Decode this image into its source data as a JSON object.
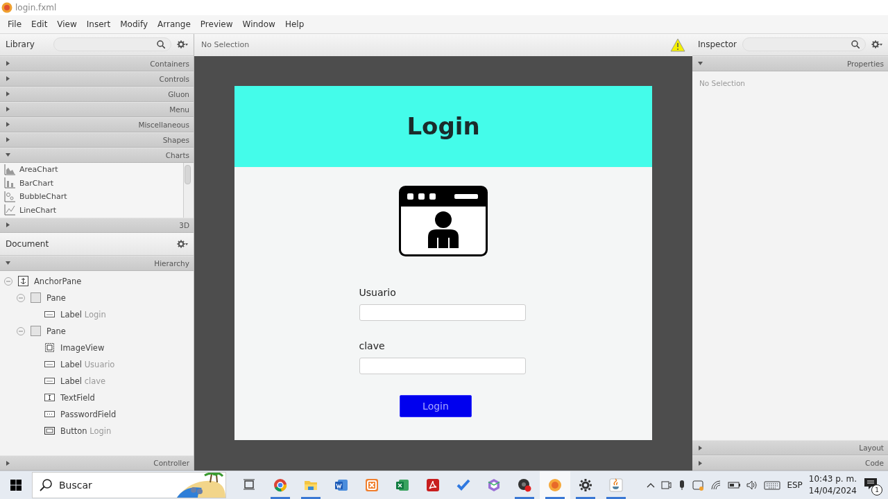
{
  "window": {
    "title": "login.fxml"
  },
  "menu": [
    "File",
    "Edit",
    "View",
    "Insert",
    "Modify",
    "Arrange",
    "Preview",
    "Window",
    "Help"
  ],
  "library": {
    "title": "Library",
    "sections": [
      {
        "label": "Containers",
        "expanded": false
      },
      {
        "label": "Controls",
        "expanded": false
      },
      {
        "label": "Gluon",
        "expanded": false
      },
      {
        "label": "Menu",
        "expanded": false
      },
      {
        "label": "Miscellaneous",
        "expanded": false
      },
      {
        "label": "Shapes",
        "expanded": false
      },
      {
        "label": "Charts",
        "expanded": true,
        "items": [
          {
            "kind": "area",
            "label": "AreaChart"
          },
          {
            "kind": "bar",
            "label": "BarChart"
          },
          {
            "kind": "bubble",
            "label": "BubbleChart"
          },
          {
            "kind": "line",
            "label": "LineChart"
          }
        ]
      },
      {
        "label": "3D",
        "expanded": false
      }
    ]
  },
  "document": {
    "title": "Document",
    "section": "Hierarchy",
    "section_expanded": true,
    "tree": [
      {
        "kind": "anchor",
        "type": "AnchorPane",
        "expanded": true,
        "children": [
          {
            "kind": "pane",
            "type": "Pane",
            "expanded": true,
            "children": [
              {
                "kind": "label",
                "type": "Label",
                "text": "Login"
              }
            ]
          },
          {
            "kind": "pane",
            "type": "Pane",
            "expanded": true,
            "children": [
              {
                "kind": "image",
                "type": "ImageView"
              },
              {
                "kind": "label",
                "type": "Label",
                "text": "Usuario"
              },
              {
                "kind": "label",
                "type": "Label",
                "text": "clave"
              },
              {
                "kind": "textfield",
                "type": "TextField"
              },
              {
                "kind": "password",
                "type": "PasswordField"
              },
              {
                "kind": "button",
                "type": "Button",
                "text": "Login"
              }
            ]
          }
        ]
      }
    ],
    "footer": "Controller"
  },
  "canvas": {
    "status": "No Selection",
    "form": {
      "title": "Login",
      "fields": [
        {
          "label": "Usuario"
        },
        {
          "label": "clave"
        }
      ],
      "button": "Login"
    }
  },
  "inspector": {
    "title": "Inspector",
    "section": "Properties",
    "empty": "No Selection",
    "sections": [
      "Layout",
      "Code"
    ]
  },
  "taskbar": {
    "search": "Buscar",
    "apps": [
      {
        "kind": "taskview",
        "running": false,
        "active": false
      },
      {
        "kind": "chrome",
        "running": true,
        "active": false
      },
      {
        "kind": "folder",
        "running": true,
        "active": false
      },
      {
        "kind": "word",
        "running": false,
        "active": false
      },
      {
        "kind": "xampp",
        "running": false,
        "active": false
      },
      {
        "kind": "excel",
        "running": false,
        "active": false
      },
      {
        "kind": "pdf",
        "running": false,
        "active": false
      },
      {
        "kind": "todo",
        "running": false,
        "active": false
      },
      {
        "kind": "cube",
        "running": false,
        "active": false
      },
      {
        "kind": "obs",
        "running": true,
        "active": false
      },
      {
        "kind": "builder",
        "running": true,
        "active": true
      },
      {
        "kind": "gear",
        "running": true,
        "active": false
      },
      {
        "kind": "java",
        "running": true,
        "active": false
      }
    ],
    "language": "ESP",
    "time": "10:43 p. m.",
    "date": "14/04/2024",
    "notifications": "1"
  }
}
